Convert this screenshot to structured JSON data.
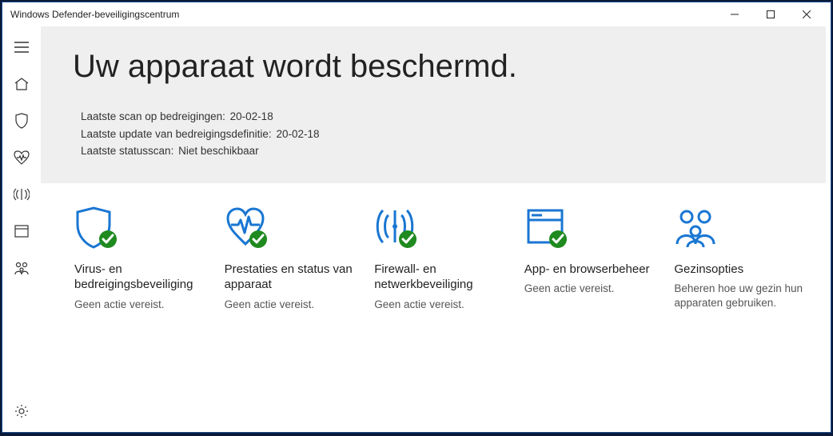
{
  "window": {
    "title": "Windows Defender-beveiligingscentrum"
  },
  "hero": {
    "heading": "Uw apparaat wordt beschermd.",
    "status": [
      {
        "label": "Laatste scan op bedreigingen:",
        "value": "20-02-18"
      },
      {
        "label": "Laatste update van bedreigingsdefinitie:",
        "value": "20-02-18"
      },
      {
        "label": "Laatste statusscan:",
        "value": "Niet beschikbaar"
      }
    ]
  },
  "sidebar": {
    "items": [
      {
        "name": "menu"
      },
      {
        "name": "home"
      },
      {
        "name": "virus-threat"
      },
      {
        "name": "device-health"
      },
      {
        "name": "firewall"
      },
      {
        "name": "app-browser"
      },
      {
        "name": "family"
      }
    ],
    "settings": {
      "name": "settings"
    }
  },
  "tiles": [
    {
      "icon": "shield",
      "badge": true,
      "title": "Virus- en bedreigingsbeveiliging",
      "desc": "Geen actie vereist."
    },
    {
      "icon": "heart",
      "badge": true,
      "title": "Prestaties en status van apparaat",
      "desc": "Geen actie vereist."
    },
    {
      "icon": "firewall",
      "badge": true,
      "title": "Firewall- en netwerkbeveiliging",
      "desc": "Geen actie vereist."
    },
    {
      "icon": "window",
      "badge": true,
      "title": "App- en browserbeheer",
      "desc": "Geen actie vereist."
    },
    {
      "icon": "family",
      "badge": false,
      "title": "Gezinsopties",
      "desc": "Beheren hoe uw gezin hun apparaten gebruiken."
    }
  ],
  "colors": {
    "accent": "#1976d2",
    "badge": "#1f8a1f"
  }
}
